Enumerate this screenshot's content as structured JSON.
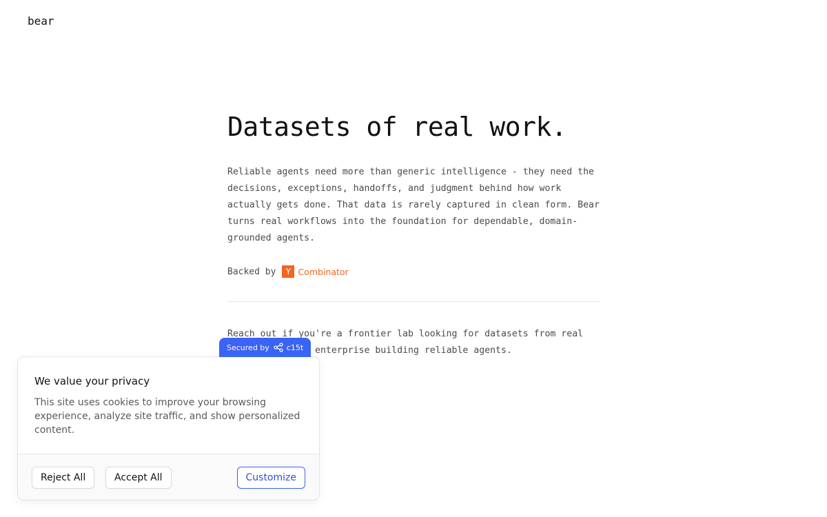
{
  "header": {
    "logo": "bear"
  },
  "hero": {
    "headline": "Datasets of real work.",
    "lead": "Reliable agents need more than generic intelligence - they need the decisions, exceptions, handoffs, and judgment behind how work actually gets done. That data is rarely captured in clean form. Bear turns real workflows into the foundation for dependable, domain-grounded agents.",
    "backed_label": "Backed by",
    "backer": {
      "mark": "Y",
      "name": "Combinator",
      "color": "#f26522"
    }
  },
  "contact": {
    "text": "Reach out if you're a frontier lab looking for datasets from real workflows or an enterprise building reliable agents."
  },
  "secured_badge": {
    "prefix": "Secured by",
    "brand": "c15t",
    "icon": "c15t-nodes-icon",
    "color": "#3b63f5"
  },
  "cookie_banner": {
    "title": "We value your privacy",
    "description": "This site uses cookies to improve your browsing experience, analyze site traffic, and show personalized content.",
    "reject_label": "Reject All",
    "accept_label": "Accept All",
    "customize_label": "Customize",
    "accent": "#3b63f5"
  }
}
